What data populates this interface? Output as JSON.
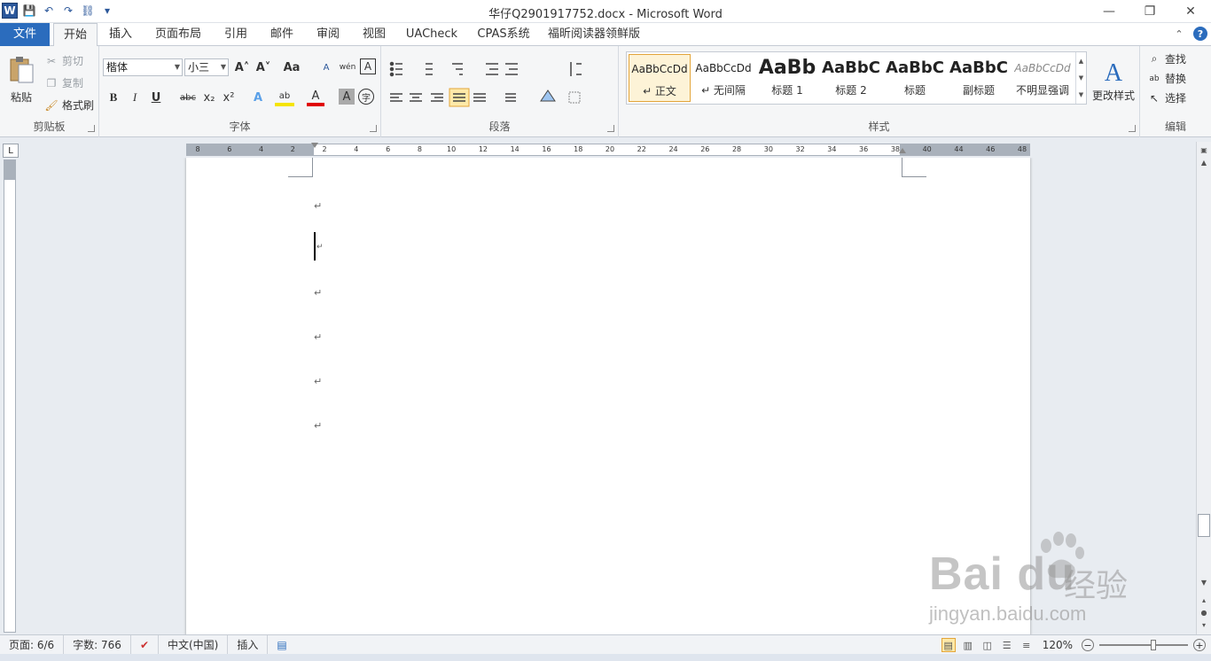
{
  "window": {
    "title": "华仔Q2901917752.docx  -  Microsoft Word",
    "minimize": "—",
    "restore": "❐",
    "close": "✕"
  },
  "qat": {
    "logo": "W",
    "save": "💾",
    "undo": "↶",
    "redo": "↷",
    "extra": "⛓",
    "more": "▾"
  },
  "tabs": [
    {
      "label": "文件"
    },
    {
      "label": "开始"
    },
    {
      "label": "插入"
    },
    {
      "label": "页面布局"
    },
    {
      "label": "引用"
    },
    {
      "label": "邮件"
    },
    {
      "label": "审阅"
    },
    {
      "label": "视图"
    },
    {
      "label": "UACheck"
    },
    {
      "label": "CPAS系统"
    },
    {
      "label": "福昕阅读器领鲜版"
    }
  ],
  "help": {
    "collapse": "⌃",
    "help": "?"
  },
  "clipboard": {
    "group_label": "剪贴板",
    "paste": "粘贴",
    "cut": "剪切",
    "copy": "复制",
    "format_painter": "格式刷"
  },
  "font": {
    "group_label": "字体",
    "font_name": "楷体",
    "font_size": "小三",
    "grow": "A˄",
    "shrink": "A˅",
    "change_case": "Aa",
    "clear": "A",
    "pinyin": "wén",
    "border": "A",
    "bold": "B",
    "italic": "I",
    "underline": "U",
    "strike": "abc",
    "subscript": "x₂",
    "superscript": "x²",
    "effects": "A",
    "highlight": "ab",
    "color": "A",
    "shading": "A",
    "enclose": "字"
  },
  "paragraph": {
    "group_label": "段落"
  },
  "styles": {
    "group_label": "样式",
    "items": [
      {
        "sample": "AaBbCcDd",
        "name": "↵ 正文"
      },
      {
        "sample": "AaBbCcDd",
        "name": "↵ 无间隔"
      },
      {
        "sample": "AaBb",
        "name": "标题 1"
      },
      {
        "sample": "AaBbC",
        "name": "标题 2"
      },
      {
        "sample": "AaBbC",
        "name": "标题"
      },
      {
        "sample": "AaBbC",
        "name": "副标题"
      },
      {
        "sample": "AaBbCcDd",
        "name": "不明显强调"
      }
    ],
    "change_styles": "更改样式"
  },
  "editing": {
    "group_label": "编辑",
    "find": "查找",
    "replace": "替换",
    "select": "选择"
  },
  "ruler": {
    "corner": "L",
    "numbers": [
      "8",
      "6",
      "4",
      "2",
      "2",
      "4",
      "6",
      "8",
      "10",
      "12",
      "14",
      "16",
      "18",
      "20",
      "22",
      "24",
      "26",
      "28",
      "30",
      "32",
      "34",
      "36",
      "38",
      "40",
      "44",
      "46",
      "48"
    ]
  },
  "document": {
    "paragraph_mark": "↵"
  },
  "statusbar": {
    "page": "页面: 6/6",
    "words": "字数: 766",
    "language": "中文(中国)",
    "mode": "插入",
    "zoom": "120%",
    "zoom_minus": "−",
    "zoom_plus": "+"
  },
  "watermark": {
    "logo": "Bai  du",
    "text": "经验",
    "url": "jingyan.baidu.com"
  }
}
